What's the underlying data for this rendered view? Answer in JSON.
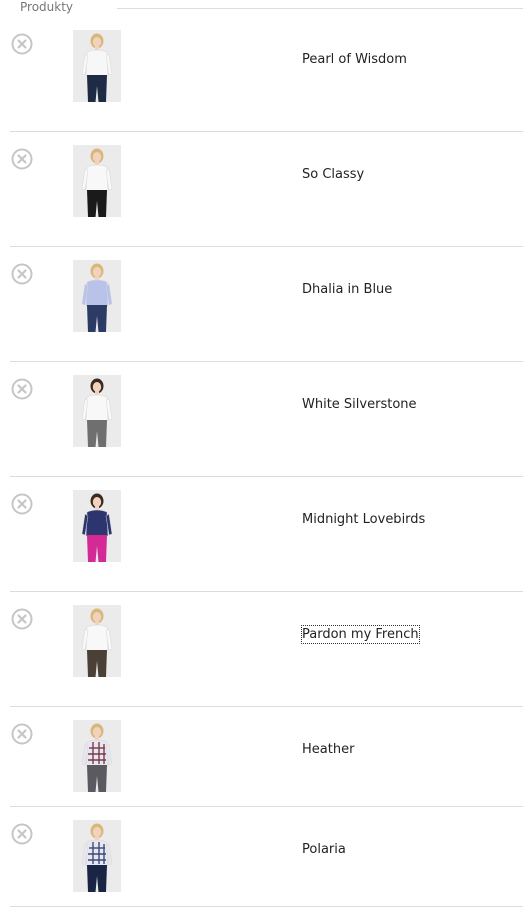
{
  "section": {
    "title": "Produkty"
  },
  "products": [
    {
      "name": "Pearl of Wisdom",
      "top_color": "#f7f7f7",
      "bottom_color": "#1f2a44",
      "hair_color": "#d9b77a",
      "pattern": "plain",
      "focused": false
    },
    {
      "name": "So Classy",
      "top_color": "#f8f8f8",
      "bottom_color": "#1a1a1a",
      "hair_color": "#d9b77a",
      "pattern": "plain",
      "focused": false
    },
    {
      "name": "Dhalia in Blue",
      "top_color": "#b9c3ea",
      "bottom_color": "#2c3a66",
      "hair_color": "#d9b77a",
      "pattern": "plain",
      "focused": false
    },
    {
      "name": "White Silverstone",
      "top_color": "#f8f8f8",
      "bottom_color": "#6f6f6f",
      "hair_color": "#3a2a20",
      "pattern": "plain",
      "focused": false
    },
    {
      "name": "Midnight Lovebirds",
      "top_color": "#2c356e",
      "bottom_color": "#d42a96",
      "hair_color": "#3a2a20",
      "pattern": "plain",
      "focused": false
    },
    {
      "name": "Pardon my French",
      "top_color": "#f8f8f8",
      "bottom_color": "#4a4036",
      "hair_color": "#d9b77a",
      "pattern": "plain",
      "focused": true
    },
    {
      "name": "Heather",
      "top_color": "#e8e6ee",
      "bottom_color": "#5a5a60",
      "hair_color": "#d9b77a",
      "pattern": "plaid",
      "plaid_color": "#7a3a4a",
      "focused": false
    },
    {
      "name": "Polaria",
      "top_color": "#e8e6ee",
      "bottom_color": "#1a2444",
      "hair_color": "#d9b77a",
      "pattern": "plaid",
      "plaid_color": "#3a4a7a",
      "focused": false
    }
  ],
  "icons": {
    "remove": "close-circle-icon"
  },
  "colors": {
    "remove_icon": "#c6c6c6",
    "divider": "#dcdcdc",
    "text": "#222222",
    "thumb_bg": "#ebebeb"
  }
}
